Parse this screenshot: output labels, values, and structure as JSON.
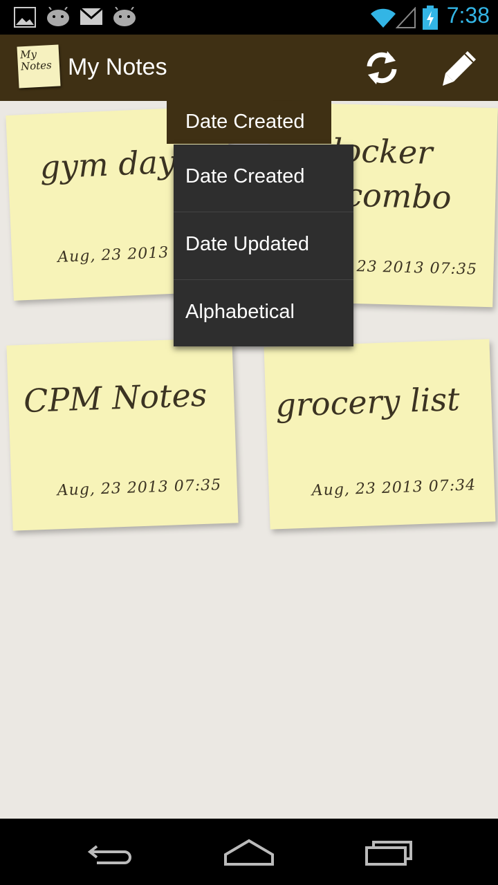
{
  "status_bar": {
    "time": "7:38",
    "icons": [
      "image-icon",
      "android-icon",
      "mail-icon",
      "android-icon",
      "wifi-icon",
      "signal-icon",
      "battery-charging-icon"
    ]
  },
  "action_bar": {
    "logo_text_line1": "My",
    "logo_text_line2": "Notes",
    "title": "My Notes",
    "actions": [
      "refresh-icon",
      "compose-pencil-icon"
    ]
  },
  "sort_spinner": {
    "selected": "Date Created",
    "options": [
      "Date Created",
      "Date Updated",
      "Alphabetical"
    ]
  },
  "notes": [
    {
      "title": "gym day",
      "date": "Aug, 23 2013"
    },
    {
      "title": "locker combo",
      "title_line1": "locker",
      "title_line2": "combo",
      "date": "23 2013 07:35"
    },
    {
      "title": "CPM Notes",
      "date": "Aug, 23 2013 07:35"
    },
    {
      "title": "grocery list",
      "date": "Aug, 23 2013 07:34"
    }
  ],
  "colors": {
    "action_bar": "#3f3014",
    "note_paper": "#f7f3b8",
    "background": "#ebe8e3",
    "accent": "#33b5e5",
    "dropdown": "#2e2e2e"
  },
  "nav_bar": {
    "buttons": [
      "back-icon",
      "home-icon",
      "recent-apps-icon"
    ]
  }
}
